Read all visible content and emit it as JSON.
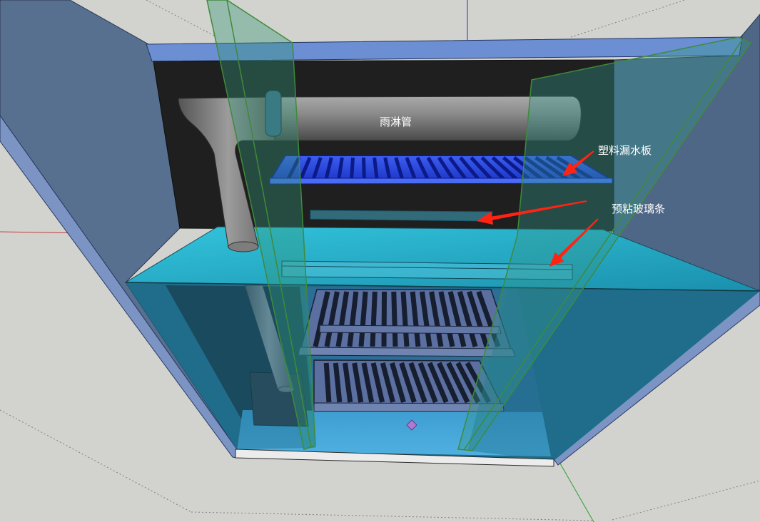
{
  "labels": {
    "rain_pipe": "雨淋管",
    "drain_plate": "塑料漏水板",
    "glass_strip": "预粘玻璃条"
  },
  "colors": {
    "background": "#d2d2ce",
    "arrow": "#ff2412",
    "label_text": "#ffffff",
    "drain_plate": "#2a4ae6",
    "shelf": "#2bb6d0",
    "pipe": "#8c8c8c",
    "glass_edge": "#3f8a3a"
  }
}
